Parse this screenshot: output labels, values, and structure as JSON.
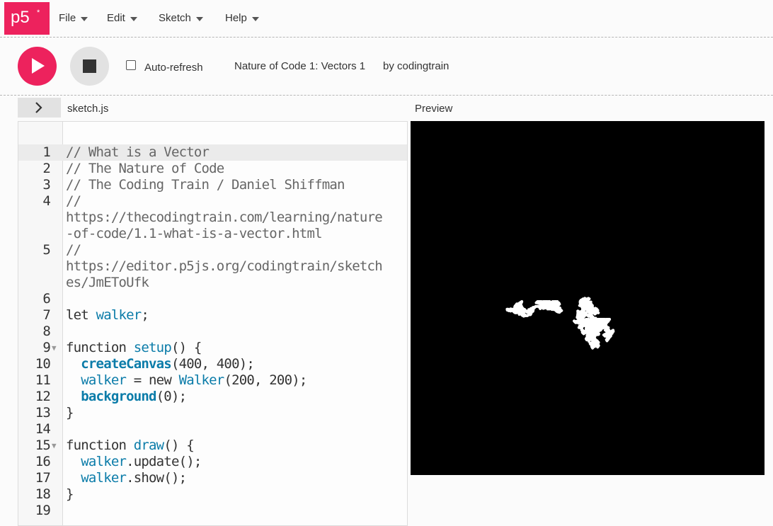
{
  "app": {
    "logo": "p5",
    "logo_mark": "*"
  },
  "menu": [
    {
      "label": "File"
    },
    {
      "label": "Edit"
    },
    {
      "label": "Sketch"
    },
    {
      "label": "Help"
    }
  ],
  "toolbar": {
    "play_icon": "play-icon",
    "stop_icon": "stop-icon",
    "autorefresh_label": "Auto-refresh",
    "autorefresh_checked": false,
    "project_name": "Nature of Code 1: Vectors 1",
    "project_owner": "by codingtrain"
  },
  "editor": {
    "sidebar_toggle_icon": "chevron-right-icon",
    "file_name": "sketch.js",
    "lines": [
      {
        "n": "1",
        "text": "// What is a Vector"
      },
      {
        "n": "2",
        "text": "// The Nature of Code"
      },
      {
        "n": "3",
        "text": "// The Coding Train / Daniel Shiffman"
      },
      {
        "n": "4",
        "text": "//"
      },
      {
        "n": "",
        "text": "https://thecodingtrain.com/learning/nature"
      },
      {
        "n": "",
        "text": "-of-code/1.1-what-is-a-vector.html"
      },
      {
        "n": "5",
        "text": "//"
      },
      {
        "n": "",
        "text": "https://editor.p5js.org/codingtrain/sketch"
      },
      {
        "n": "",
        "text": "es/JmEToUfk"
      },
      {
        "n": "6",
        "text": ""
      },
      {
        "n": "7",
        "text": "let walker;"
      },
      {
        "n": "8",
        "text": ""
      },
      {
        "n": "9",
        "text": "function setup() {",
        "fold": "▼"
      },
      {
        "n": "10",
        "text": "  createCanvas(400, 400);"
      },
      {
        "n": "11",
        "text": "  walker = new Walker(200, 200);"
      },
      {
        "n": "12",
        "text": "  background(0);"
      },
      {
        "n": "13",
        "text": "}"
      },
      {
        "n": "14",
        "text": ""
      },
      {
        "n": "15",
        "text": "function draw() {",
        "fold": "▼"
      },
      {
        "n": "16",
        "text": "  walker.update();"
      },
      {
        "n": "17",
        "text": "  walker.show();"
      },
      {
        "n": "18",
        "text": "}"
      },
      {
        "n": "19",
        "text": ""
      }
    ]
  },
  "preview": {
    "label": "Preview",
    "canvas_background": "#000000",
    "walker_color": "#ffffff"
  },
  "colors": {
    "accent": "#ed225d",
    "code_function": "#0b7ca9"
  }
}
